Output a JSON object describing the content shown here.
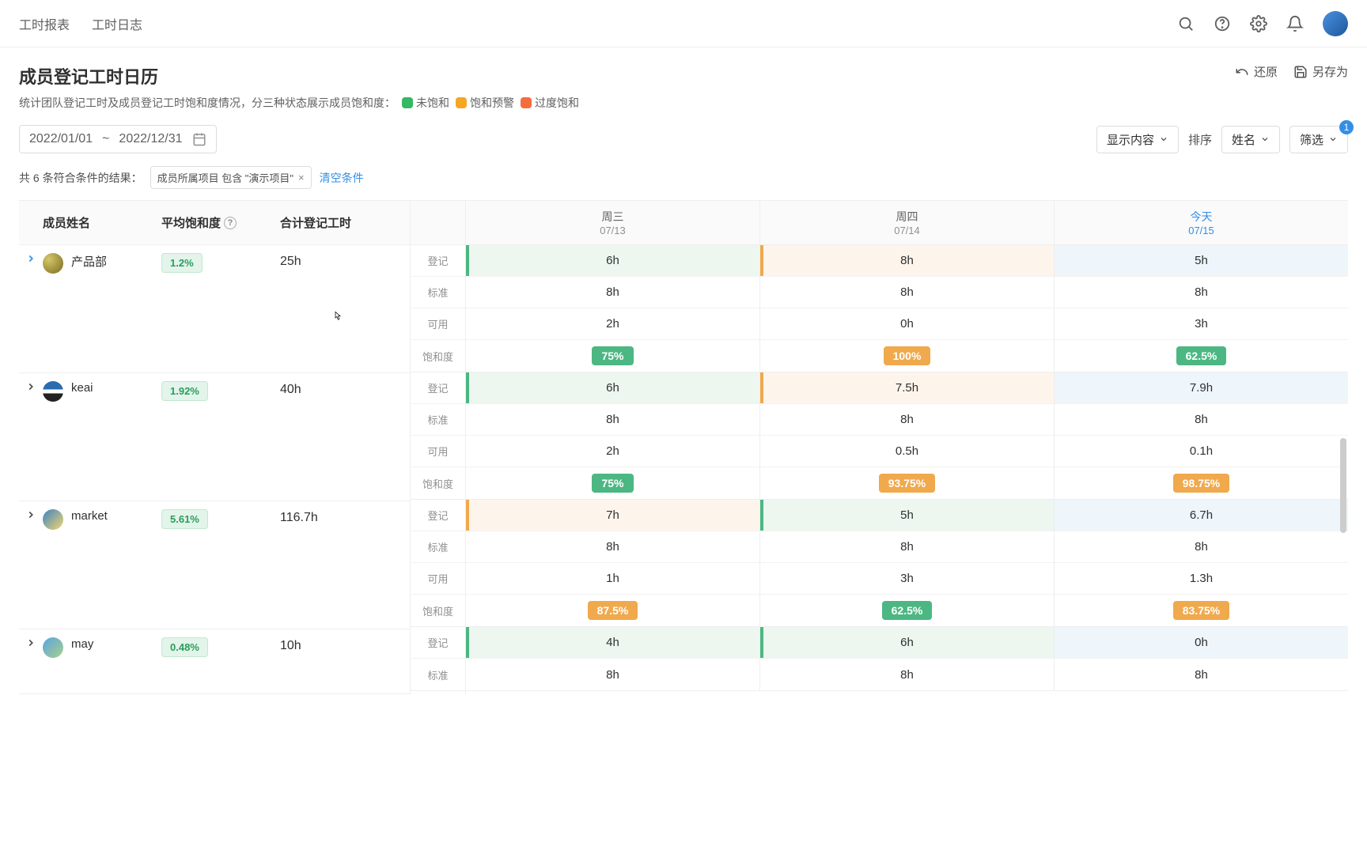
{
  "topbar": {
    "tab1": "工时报表",
    "tab2": "工时日志"
  },
  "page": {
    "title": "成员登记工时日历",
    "desc_prefix": "统计团队登记工时及成员登记工时饱和度情况，分三种状态展示成员饱和度：",
    "legend": {
      "unsat": "未饱和",
      "warn": "饱和预警",
      "over": "过度饱和"
    },
    "restore": "还原",
    "save_as": "另存为"
  },
  "toolbar": {
    "date_start": "2022/01/01",
    "date_sep": "~",
    "date_end": "2022/12/31",
    "display": "显示内容",
    "sort_label": "排序",
    "sort_value": "姓名",
    "filter": "筛选",
    "filter_count": "1"
  },
  "filterbar": {
    "prefix": "共 6 条符合条件的结果：",
    "chip": "成员所属项目 包含 \"演示项目\"",
    "clear": "清空条件"
  },
  "headers": {
    "name": "成员姓名",
    "avg_sat": "平均饱和度",
    "total": "合计登记工时"
  },
  "row_labels": {
    "reg": "登记",
    "std": "标准",
    "avail": "可用",
    "sat": "饱和度"
  },
  "days": [
    {
      "name": "周三",
      "date": "07/13",
      "today": false
    },
    {
      "name": "周四",
      "date": "07/14",
      "today": false
    },
    {
      "name": "今天",
      "date": "07/15",
      "today": true
    }
  ],
  "members": [
    {
      "name": "产品部",
      "avatar": "av1",
      "expand_color": "#338fe5",
      "avg_sat": "1.2%",
      "total": "25h",
      "cells": [
        {
          "reg": "6h",
          "reg_bg": "bg-green-light",
          "bar": "bar-green",
          "std": "8h",
          "avail": "2h",
          "sat": "75%",
          "sat_pill": "pill-green"
        },
        {
          "reg": "8h",
          "reg_bg": "bg-orange-light",
          "bar": "bar-orange",
          "std": "8h",
          "avail": "0h",
          "sat": "100%",
          "sat_pill": "pill-orange"
        },
        {
          "reg": "5h",
          "reg_bg": "bg-blue-light",
          "bar": "",
          "std": "8h",
          "avail": "3h",
          "sat": "62.5%",
          "sat_pill": "pill-green"
        }
      ]
    },
    {
      "name": "keai",
      "avatar": "av2",
      "expand_color": "#505050",
      "avg_sat": "1.92%",
      "total": "40h",
      "cells": [
        {
          "reg": "6h",
          "reg_bg": "bg-green-light",
          "bar": "bar-green",
          "std": "8h",
          "avail": "2h",
          "sat": "75%",
          "sat_pill": "pill-green"
        },
        {
          "reg": "7.5h",
          "reg_bg": "bg-orange-light",
          "bar": "bar-orange",
          "std": "8h",
          "avail": "0.5h",
          "sat": "93.75%",
          "sat_pill": "pill-orange"
        },
        {
          "reg": "7.9h",
          "reg_bg": "bg-blue-light",
          "bar": "",
          "std": "8h",
          "avail": "0.1h",
          "sat": "98.75%",
          "sat_pill": "pill-orange"
        }
      ]
    },
    {
      "name": "market",
      "avatar": "av3",
      "expand_color": "#505050",
      "avg_sat": "5.61%",
      "total": "116.7h",
      "cells": [
        {
          "reg": "7h",
          "reg_bg": "bg-orange-light",
          "bar": "bar-orange",
          "std": "8h",
          "avail": "1h",
          "sat": "87.5%",
          "sat_pill": "pill-orange"
        },
        {
          "reg": "5h",
          "reg_bg": "bg-green-light",
          "bar": "bar-green",
          "std": "8h",
          "avail": "3h",
          "sat": "62.5%",
          "sat_pill": "pill-green"
        },
        {
          "reg": "6.7h",
          "reg_bg": "bg-blue-light",
          "bar": "",
          "std": "8h",
          "avail": "1.3h",
          "sat": "83.75%",
          "sat_pill": "pill-orange"
        }
      ]
    },
    {
      "name": "may",
      "avatar": "av4",
      "expand_color": "#505050",
      "avg_sat": "0.48%",
      "total": "10h",
      "cells": [
        {
          "reg": "4h",
          "reg_bg": "bg-green-light",
          "bar": "bar-green",
          "std": "8h",
          "avail": "",
          "sat": "",
          "sat_pill": ""
        },
        {
          "reg": "6h",
          "reg_bg": "bg-green-light",
          "bar": "bar-green",
          "std": "8h",
          "avail": "",
          "sat": "",
          "sat_pill": ""
        },
        {
          "reg": "0h",
          "reg_bg": "bg-blue-light",
          "bar": "",
          "std": "8h",
          "avail": "",
          "sat": "",
          "sat_pill": ""
        }
      ],
      "partial": true
    }
  ]
}
